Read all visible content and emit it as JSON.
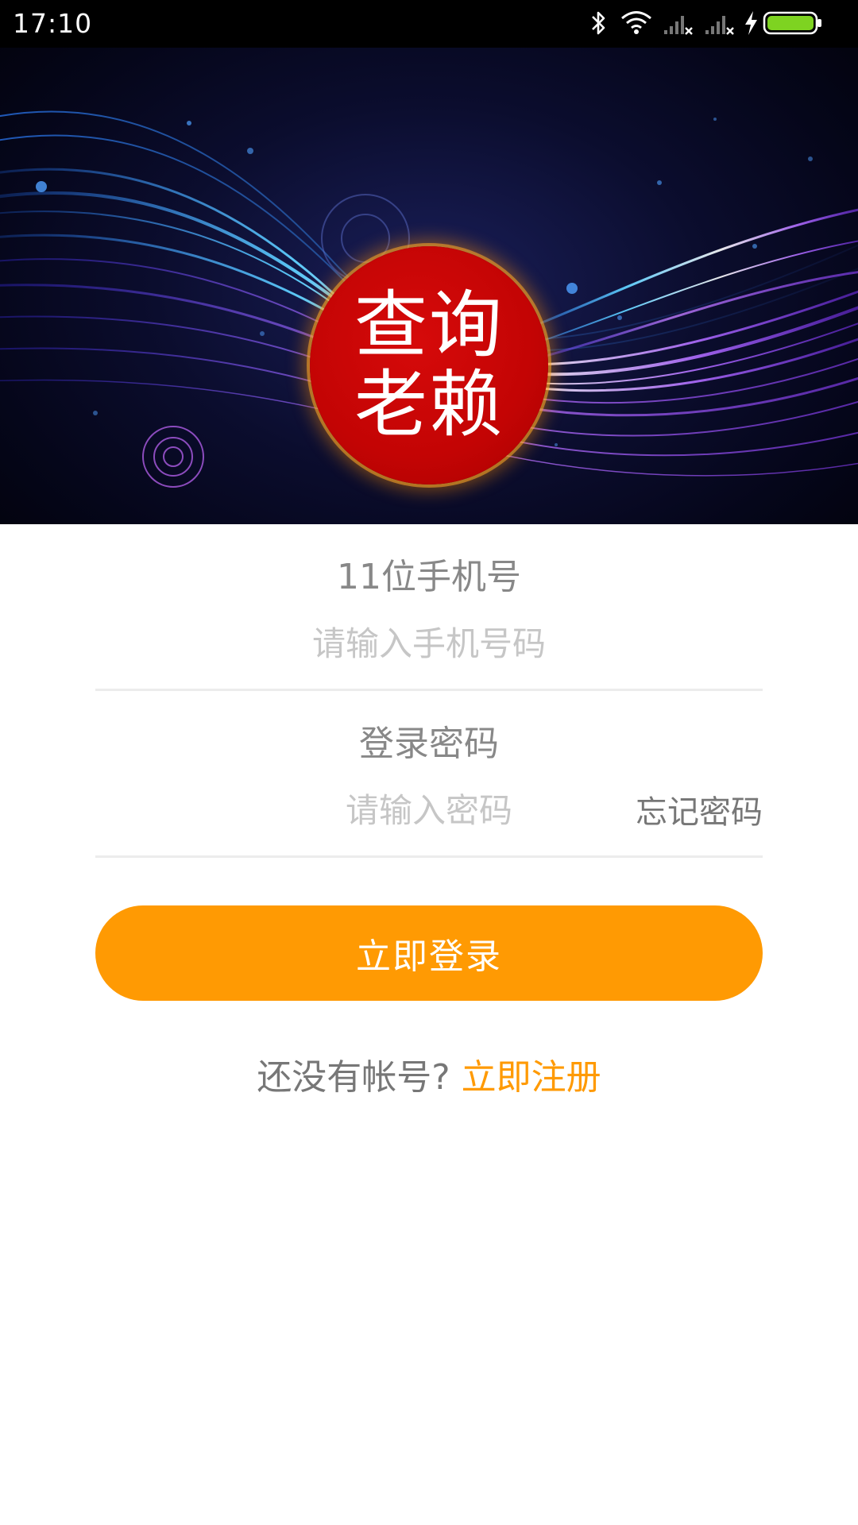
{
  "status_bar": {
    "time": "17:10",
    "icons": [
      "bluetooth-icon",
      "wifi-icon",
      "signal-icon",
      "signal-icon",
      "charging-icon",
      "battery-icon"
    ],
    "battery_color": "#7ed321"
  },
  "logo": {
    "line1": "查询",
    "line2": "老赖",
    "color": "#c30404"
  },
  "form": {
    "phone_label": "11位手机号",
    "phone_placeholder": "请输入手机号码",
    "password_label": "登录密码",
    "password_placeholder": "请输入密码",
    "forgot_password": "忘记密码",
    "login_button": "立即登录",
    "register_prompt": "还没有帐号?",
    "register_link": "立即注册"
  },
  "colors": {
    "accent": "#ff9a03",
    "label_gray": "#888888",
    "placeholder_gray": "#c6c6c6",
    "divider": "#ececec"
  }
}
